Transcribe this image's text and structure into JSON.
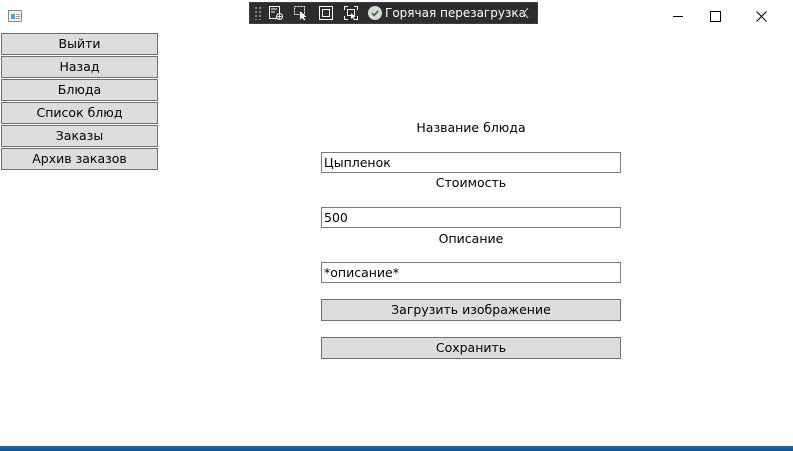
{
  "window": {
    "icon": "app-window-icon",
    "caption_buttons": [
      "minimize-icon",
      "maximize-icon",
      "close-icon"
    ]
  },
  "debug_toolbar": {
    "tools": [
      "live-visual-tree-icon",
      "select-element-icon",
      "display-layout-adorners-icon",
      "track-focus-icon"
    ],
    "hot_reload_label": "Горячая перезагрузка",
    "status_icon": "check-circle-icon",
    "collapse_icon": "chevron-left-icon"
  },
  "nav": {
    "items": [
      {
        "label": "Выйти"
      },
      {
        "label": "Назад"
      },
      {
        "label": "Блюда"
      },
      {
        "label": "Список блюд"
      },
      {
        "label": "Заказы"
      },
      {
        "label": "Архив заказов"
      }
    ]
  },
  "form": {
    "name_label": "Название блюда",
    "name_value": "Цыпленок",
    "price_label": "Стоимость",
    "price_value": "500",
    "description_label": "Описание",
    "description_value": "*описание*",
    "upload_button": "Загрузить изображение",
    "save_button": "Сохранить"
  },
  "colors": {
    "button_background": "#dddddd",
    "button_border": "#707070",
    "debug_toolbar_background": "#2d2d30",
    "taskbar": "#0b4c86"
  }
}
